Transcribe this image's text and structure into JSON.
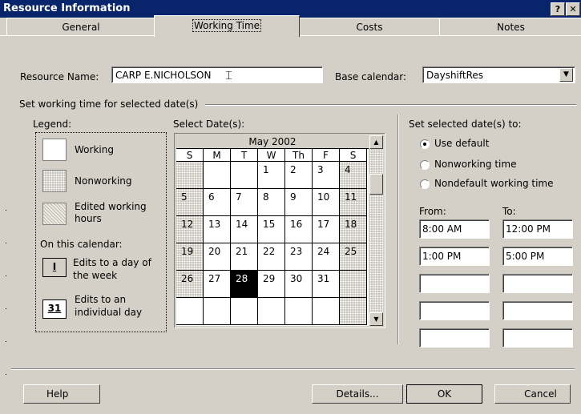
{
  "dialog": {
    "title": "Resource Information",
    "help_glyph": "?",
    "close_glyph": "✕"
  },
  "tabs": [
    {
      "label": "General",
      "active": false
    },
    {
      "label": "Working Time",
      "active": true
    },
    {
      "label": "Costs",
      "active": false
    },
    {
      "label": "Notes",
      "active": false
    }
  ],
  "resource": {
    "name_label": "Resource Name:",
    "name_value": "CARP E.NICHOLSON",
    "base_calendar_label": "Base calendar:",
    "base_calendar_value": "DayshiftRes"
  },
  "group_title": "Set working time for selected date(s)",
  "legend": {
    "title": "Legend:",
    "working": "Working",
    "nonworking": "Nonworking",
    "edited": "Edited working hours",
    "on_calendar": "On this calendar:",
    "day_of_week_glyph": "I",
    "day_of_week": "Edits to a day of the week",
    "individual_day_glyph": "31",
    "individual_day": "Edits to an individual day"
  },
  "calendar": {
    "select_label": "Select Date(s):",
    "month": "May 2002",
    "weekdays": [
      "S",
      "M",
      "T",
      "W",
      "Th",
      "F",
      "S"
    ],
    "weeks": [
      [
        "",
        "",
        "",
        "1",
        "2",
        "3",
        "4"
      ],
      [
        "5",
        "6",
        "7",
        "8",
        "9",
        "10",
        "11"
      ],
      [
        "12",
        "13",
        "14",
        "15",
        "16",
        "17",
        "18"
      ],
      [
        "19",
        "20",
        "21",
        "22",
        "23",
        "24",
        "25"
      ],
      [
        "26",
        "27",
        "28",
        "29",
        "30",
        "31",
        ""
      ],
      [
        "",
        "",
        "",
        "",
        "",
        "",
        ""
      ]
    ],
    "selected_day": "28"
  },
  "set_dates": {
    "title": "Set selected date(s) to:",
    "options": [
      {
        "label": "Use default",
        "selected": true
      },
      {
        "label": "Nonworking time",
        "selected": false
      },
      {
        "label": "Nondefault working time",
        "selected": false
      }
    ],
    "from_label": "From:",
    "to_label": "To:",
    "shifts": [
      {
        "from": "8:00 AM",
        "to": "12:00 PM"
      },
      {
        "from": "1:00 PM",
        "to": "5:00 PM"
      },
      {
        "from": "",
        "to": ""
      },
      {
        "from": "",
        "to": ""
      },
      {
        "from": "",
        "to": ""
      }
    ]
  },
  "buttons": {
    "help": "Help",
    "details": "Details...",
    "ok": "OK",
    "cancel": "Cancel"
  },
  "colors": {
    "titlebar": "#08246b",
    "face": "#d4d0c8",
    "selected_day": "#000000"
  }
}
